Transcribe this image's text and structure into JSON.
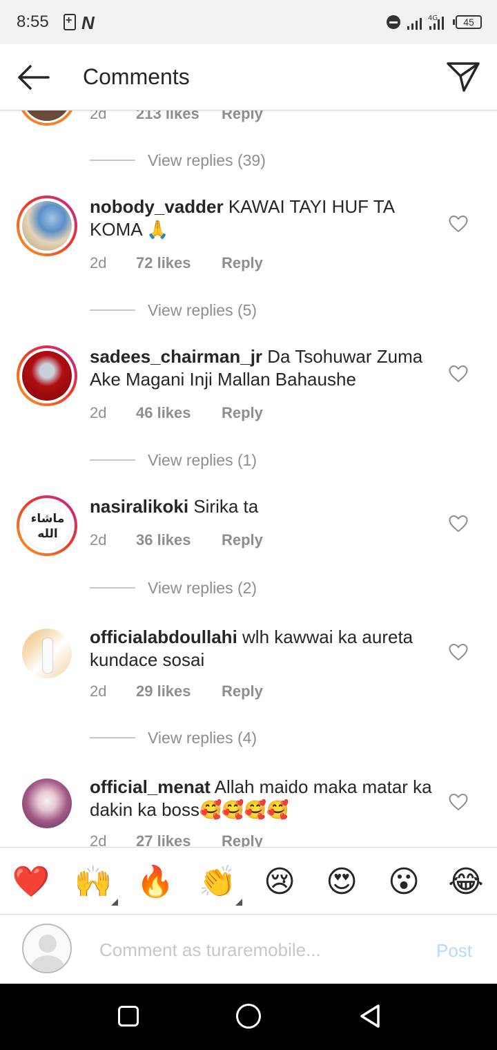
{
  "status_bar": {
    "time": "8:55",
    "battery": "45",
    "network": "4G",
    "icons": [
      "battery-saver-icon",
      "n-notification-icon",
      "dnd-icon",
      "signal-icon",
      "battery-icon"
    ]
  },
  "header": {
    "title": "Comments",
    "back_icon": "arrow-left-icon",
    "send_icon": "direct-send-icon"
  },
  "partial_comment": {
    "time": "2d",
    "likes": "213 likes",
    "reply": "Reply"
  },
  "view_replies": [
    "View replies (39)",
    "View replies (5)",
    "View replies (1)",
    "View replies (2)",
    "View replies (4)"
  ],
  "comments": [
    {
      "username": "nobody_vadder",
      "text": "KAWAI TAYI HUF TA KOMA 🙏",
      "time": "2d",
      "likes": "72 likes",
      "reply": "Reply"
    },
    {
      "username": "sadees_chairman_jr",
      "text": "Da Tsohuwar Zuma Ake Magani Inji Mallan Bahaushe",
      "time": "2d",
      "likes": "46 likes",
      "reply": "Reply"
    },
    {
      "username": "nasiralikoki",
      "text": "Sirika ta",
      "time": "2d",
      "likes": "36 likes",
      "reply": "Reply",
      "avatar_text": "ماشاء الله"
    },
    {
      "username": "officialabdoullahi",
      "text": "wlh kawwai ka aureta kundace sosai",
      "time": "2d",
      "likes": "29 likes",
      "reply": "Reply"
    },
    {
      "username": "official_menat",
      "text": "Allah maido maka matar ka dakin ka boss🥰🥰🥰🥰",
      "time": "2d",
      "likes": "27 likes",
      "reply": "Reply"
    }
  ],
  "emoji_bar": [
    "❤️",
    "🙌",
    "🔥",
    "👏",
    "😢",
    "😍",
    "😮",
    "😂"
  ],
  "comment_box": {
    "placeholder": "Comment as turaremobile...",
    "post_label": "Post"
  },
  "colors": {
    "accent_post": "#b3dbff",
    "muted_text": "#8e8e8e",
    "ring_orange": "#f9a021",
    "ring_magenta": "#c0249b"
  }
}
